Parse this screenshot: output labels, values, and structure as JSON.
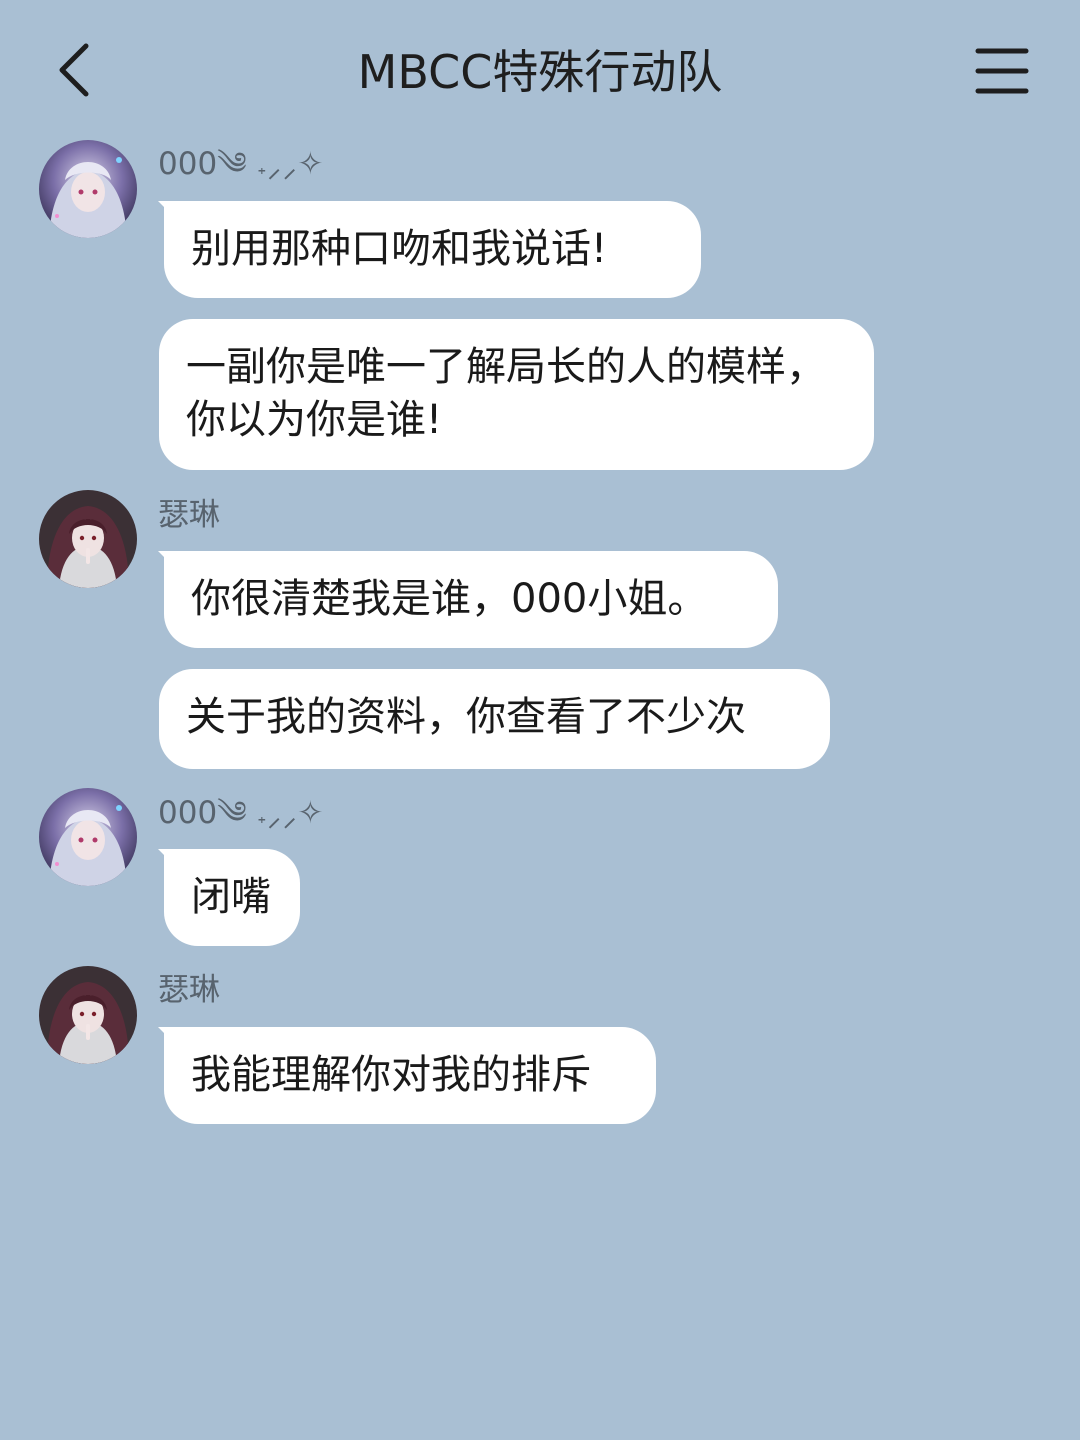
{
  "header": {
    "title": "MBCC特殊行动队",
    "back_icon": "chevron-left-icon",
    "menu_icon": "hamburger-menu-icon"
  },
  "colors": {
    "background": "#a9bfd3",
    "bubble": "#ffffff",
    "name_text": "#58636e"
  },
  "messages": [
    {
      "sender": "000༄ 𝅄⸝⸝✧",
      "text": "别用那种口吻和我说话!",
      "avatar": "avatar-000"
    },
    {
      "sender": "",
      "text": "一副你是唯一了解局长的人的模样，你以为你是谁!",
      "avatar": ""
    },
    {
      "sender": "瑟琳",
      "text": "你很清楚我是谁，000小姐。",
      "avatar": "avatar-selene"
    },
    {
      "sender": "",
      "text": "关于我的资料，你查看了不少次",
      "avatar": ""
    },
    {
      "sender": "000༄ 𝅄⸝⸝✧",
      "text": "闭嘴",
      "avatar": "avatar-000"
    },
    {
      "sender": "瑟琳",
      "text": "我能理解你对我的排斥",
      "avatar": "avatar-selene"
    }
  ]
}
